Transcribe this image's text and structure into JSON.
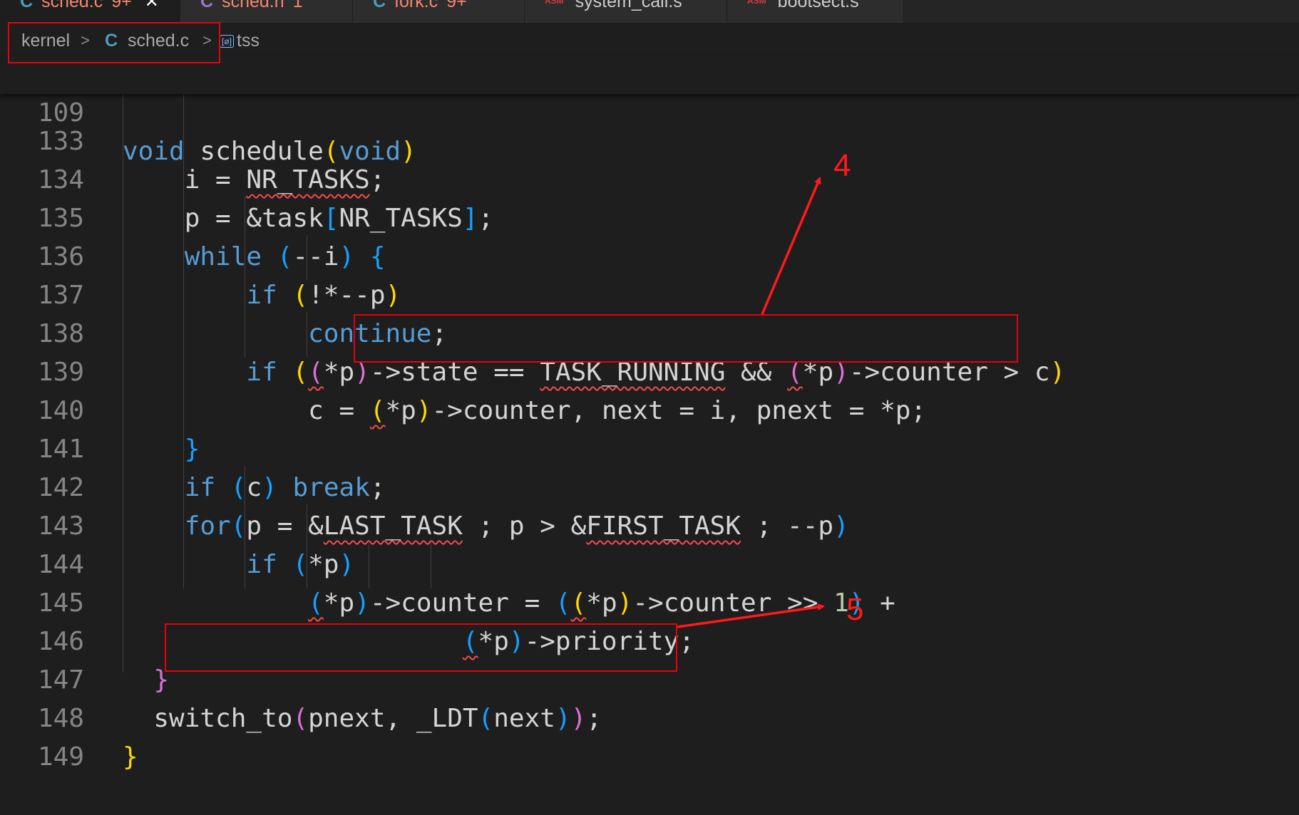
{
  "tabs": [
    {
      "icon": "C",
      "name": "sched.c",
      "badge": "9+",
      "active": true,
      "close": "✕"
    },
    {
      "icon": "C",
      "name": "sched.h",
      "badge": "1"
    },
    {
      "icon": "C",
      "name": "fork.c",
      "badge": "9+"
    },
    {
      "icon": "ASM",
      "name": "system_call.s"
    },
    {
      "icon": "ASM",
      "name": "bootsect.s"
    }
  ],
  "breadcrumb": {
    "folder": "kernel",
    "file_icon": "C",
    "file": "sched.c",
    "symbol": "tss"
  },
  "sticky": {
    "ln": "109",
    "void1": "void",
    "name": "schedule",
    "lp": "(",
    "void2": "void",
    "rp": ")"
  },
  "lines": {
    "l133": {
      "ln": "133",
      "a": "i = ",
      "b": "NR_TASKS",
      "c": ";"
    },
    "l134": {
      "ln": "134",
      "a": "p = &task",
      "b": "[",
      "c": "NR_TASKS",
      "d": "]",
      "e": ";"
    },
    "l135": {
      "ln": "135",
      "a": "while",
      "b": " ",
      "c": "(",
      "d": "--i",
      "e": ")",
      "f": " ",
      "g": "{"
    },
    "l136": {
      "ln": "136",
      "a": "if",
      "b": " ",
      "c": "(",
      "d": "!*--p",
      "e": ")"
    },
    "l137": {
      "ln": "137",
      "a": "continue",
      "b": ";"
    },
    "l138": {
      "ln": "138",
      "a": "if",
      "b": " ",
      "c": "(",
      "d": "(",
      "e": "*p",
      "f": ")",
      "g": "->state == ",
      "h": "TASK_RUNNING",
      "i": " && ",
      "j": "(",
      "k": "*p",
      "l": ")",
      "m": "->counter > c",
      "n": ")"
    },
    "l139": {
      "ln": "139",
      "a": "c = ",
      "b": "(",
      "c": "*p",
      "d": ")",
      "e": "->counter, next = i, pnext = *p;"
    },
    "l140": {
      "ln": "140",
      "a": "}"
    },
    "l141": {
      "ln": "141",
      "a": "if",
      "b": " ",
      "c": "(",
      "d": "c",
      "e": ")",
      "f": " ",
      "g": "break",
      "h": ";"
    },
    "l142": {
      "ln": "142",
      "a": "for",
      "b": "(",
      "c": "p = &",
      "d": "LAST_TASK",
      "e": " ; p > &",
      "f": "FIRST_TASK",
      "g": " ; --p",
      "h": ")"
    },
    "l143": {
      "ln": "143",
      "a": "if",
      "b": " ",
      "c": "(",
      "d": "*p",
      "e": ")"
    },
    "l144": {
      "ln": "144",
      "a": "(",
      "b": "*p",
      "c": ")",
      "d": "->counter = ",
      "e": "(",
      "f": "(",
      "g": "*p",
      "h": ")",
      "i": "->counter >> ",
      "j": "1",
      "k": ")",
      "l": " +"
    },
    "l145": {
      "ln": "145",
      "a": "(",
      "b": "*p",
      "c": ")",
      "d": "->priority;"
    },
    "l146": {
      "ln": "146",
      "a": "}"
    },
    "l147": {
      "ln": "147",
      "a": "switch_to",
      "b": "(",
      "c": "pnext, _LDT",
      "d": "(",
      "e": "next",
      "f": ")",
      "g": ")",
      "h": ";"
    },
    "l148": {
      "ln": "148",
      "a": "}"
    },
    "l149": {
      "ln": "149"
    }
  },
  "annotations": {
    "n4": "4",
    "n5": "5"
  },
  "colors": {
    "annotation": "#e8000b",
    "keyword": "#569cd6",
    "bracket1": "#ffd700",
    "bracket2": "#da70d6",
    "bracket3": "#179fff"
  }
}
